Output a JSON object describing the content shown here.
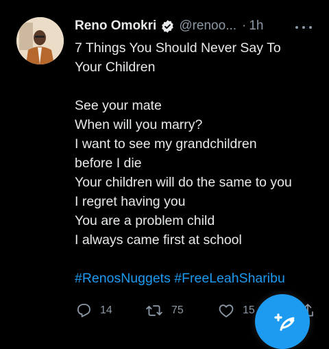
{
  "tweet": {
    "author_name": "Reno Omokri",
    "handle": "@renoo...",
    "separator": "·",
    "time": "1h",
    "lines": [
      "7 Things You Should Never Say To",
      "Your Children",
      "",
      "See your mate",
      "When will you marry?",
      "I want to see my grandchildren",
      "before I die",
      "Your children will do the same to you",
      "I regret having you",
      "You are a problem child",
      "I always came first at school",
      ""
    ],
    "hashtags": "#RenosNuggets #FreeLeahSharibu",
    "reply_count": "14",
    "retweet_count": "75",
    "like_count": "15"
  },
  "icons": {
    "verified": "verified-badge-icon",
    "more": "more-options-icon",
    "reply": "reply-icon",
    "retweet": "retweet-icon",
    "like": "like-icon",
    "share": "share-icon",
    "compose": "compose-tweet-icon"
  },
  "colors": {
    "background": "#000000",
    "text": "#e7e9ea",
    "secondary": "#8b98a5",
    "accent": "#1d9bf0"
  }
}
